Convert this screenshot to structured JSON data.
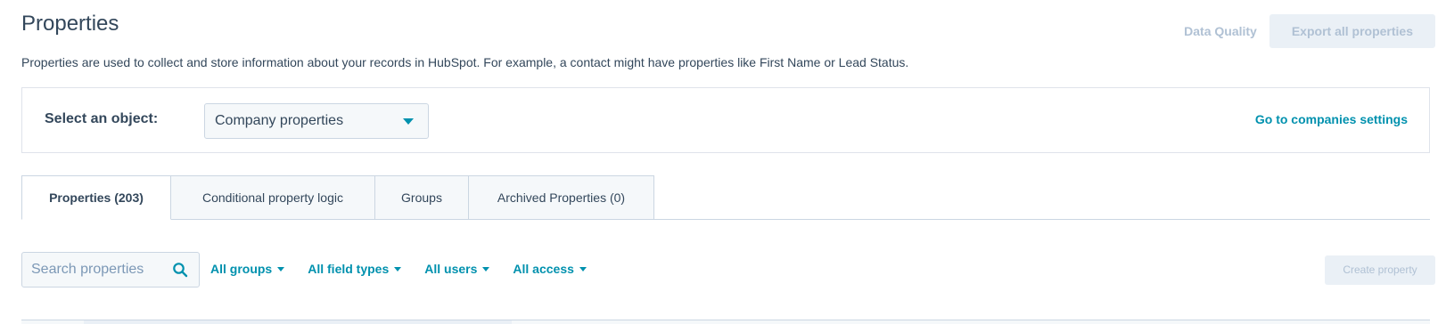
{
  "header": {
    "title": "Properties",
    "data_quality_label": "Data Quality",
    "export_label": "Export all properties",
    "description": "Properties are used to collect and store information about your records in HubSpot. For example, a contact might have properties like First Name or Lead Status."
  },
  "object_selector": {
    "label": "Select an object:",
    "selected": "Company properties",
    "settings_link": "Go to companies settings"
  },
  "tabs": [
    {
      "label": "Properties (203)",
      "active": true
    },
    {
      "label": "Conditional property logic",
      "active": false
    },
    {
      "label": "Groups",
      "active": false
    },
    {
      "label": "Archived Properties (0)",
      "active": false
    }
  ],
  "filters": {
    "search_placeholder": "Search properties",
    "all_groups": "All groups",
    "all_field_types": "All field types",
    "all_users": "All users",
    "all_access": "All access",
    "create_label": "Create property"
  },
  "colors": {
    "accent": "#0091ae",
    "text": "#33475b",
    "disabled_text": "#b0c1d4",
    "border": "#cbd6e2"
  },
  "icons": {
    "search": "search-icon",
    "dropdown": "chevron-down-icon"
  }
}
